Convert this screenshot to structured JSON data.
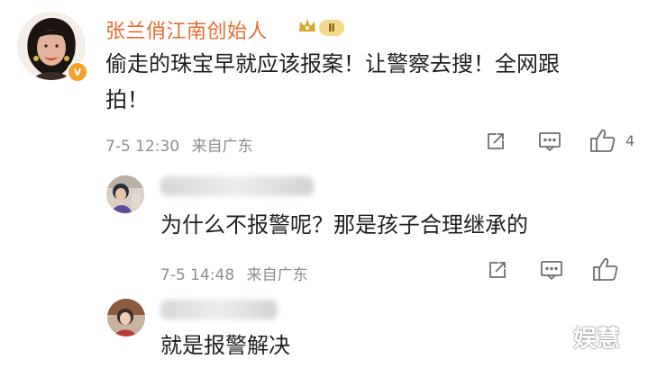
{
  "comments": [
    {
      "author": "张兰俏江南创始人",
      "level_badge": "Ⅱ",
      "text_line1": "偷走的珠宝早就应该报案！让警察去搜！全网跟",
      "text_line2": "拍！",
      "time": "7-5 12:30",
      "location": "来自广东",
      "like_count": "4"
    },
    {
      "text": "为什么不报警呢？那是孩子合理继承的",
      "time": "7-5 14:48",
      "location": "来自广东"
    },
    {
      "text": "就是报警解决"
    }
  ],
  "watermark": "娱慧",
  "icons": {
    "share": "share-icon",
    "comment": "comment-icon",
    "like": "thumbs-up-icon",
    "crown": "crown-icon",
    "verified": "verified-icon"
  },
  "colors": {
    "author_name": "#e86b2f",
    "verified_badge": "#f6a12e",
    "meta_text": "#8e8e8e"
  }
}
